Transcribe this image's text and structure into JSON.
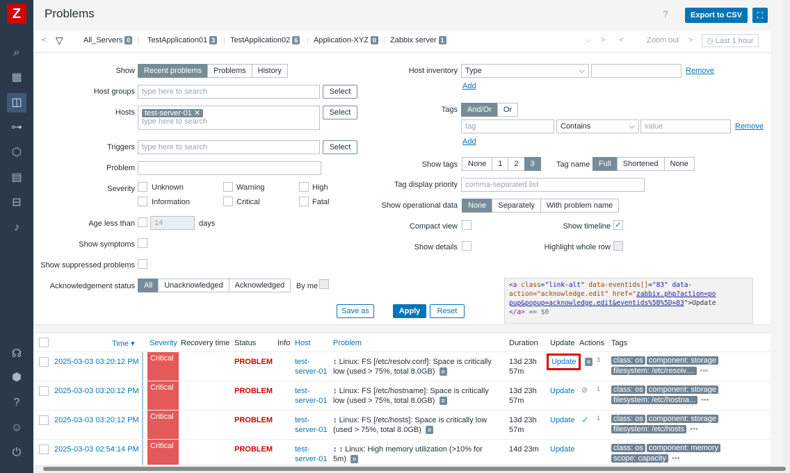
{
  "header": {
    "title": "Problems",
    "export_label": "Export to CSV",
    "help": "?"
  },
  "sidebar": {
    "logo": "Z",
    "items": [
      "search-icon",
      "dashboard-icon",
      "monitoring-icon",
      "services-icon",
      "inventory-icon",
      "reports-icon",
      "data-collection-icon",
      "alerts-icon"
    ],
    "bottom": [
      "support-icon",
      "integrations-icon",
      "help-icon",
      "user-settings-icon",
      "sign-out-icon"
    ]
  },
  "tabs": {
    "items": [
      {
        "label": "All_Servers",
        "count": "0"
      },
      {
        "label": "TestApplication01",
        "count": "3"
      },
      {
        "label": "TestApplication02",
        "count": "6"
      },
      {
        "label": "Application-XYZ",
        "count": "0"
      },
      {
        "label": "Zabbix server",
        "count": "1"
      }
    ],
    "zoom_out": "Zoom out",
    "last": "Last 1 hour"
  },
  "filter": {
    "show_label": "Show",
    "show_opts": [
      "Recent problems",
      "Problems",
      "History"
    ],
    "host_groups_label": "Host groups",
    "host_groups_placeholder": "type here to search",
    "select": "Select",
    "hosts_label": "Hosts",
    "host_chip": "test-server-01",
    "hosts_placeholder": "type here to search",
    "triggers_label": "Triggers",
    "triggers_placeholder": "type here to search",
    "problem_label": "Problem",
    "severity_label": "Severity",
    "severities": [
      "Unknown",
      "Warning",
      "High",
      "Information",
      "Critical",
      "Fatal"
    ],
    "age_label": "Age less than",
    "age_value": "14",
    "age_unit": "days",
    "symptoms_label": "Show symptoms",
    "suppressed_label": "Show suppressed problems",
    "ack_label": "Acknowledgement status",
    "ack_opts": [
      "All",
      "Unacknowledged",
      "Acknowledged"
    ],
    "by_me": "By me",
    "inventory_label": "Host inventory",
    "inventory_value": "Type",
    "remove": "Remove",
    "add": "Add",
    "tags_label": "Tags",
    "tags_opts": [
      "And/Or",
      "Or"
    ],
    "tag_placeholder": "tag",
    "tag_op": "Contains",
    "value_placeholder": "value",
    "show_tags_label": "Show tags",
    "show_tags_opts": [
      "None",
      "1",
      "2",
      "3"
    ],
    "tag_name_label": "Tag name",
    "tag_name_opts": [
      "Full",
      "Shortened",
      "None"
    ],
    "tag_priority_label": "Tag display priority",
    "tag_priority_placeholder": "comma-separated list",
    "opdata_label": "Show operational data",
    "opdata_opts": [
      "None",
      "Separately",
      "With problem name"
    ],
    "compact_label": "Compact view",
    "timeline_label": "Show timeline",
    "details_label": "Show details",
    "highlight_label": "Highlight whole row",
    "save_as": "Save as",
    "apply": "Apply",
    "reset": "Reset"
  },
  "tooltip": {
    "line1a": "<a ",
    "line1b": "class",
    "line1c": "=\"link-alt\" ",
    "line1d": "data-eventids[]",
    "line1e": "=\"83\" data-",
    "line2": "action=\"acknowledge.edit\" href=\"",
    "line2u": "zabbix.php?action=po",
    "line3u": "pup&popup=acknowledge.edit&eventids%5B%5D=83",
    "line3b": "\">Update",
    "line4": "</a>",
    "line4c": " == $0"
  },
  "table": {
    "headers": {
      "time": "Time ▾",
      "severity": "Severity",
      "recovery": "Recovery time",
      "status": "Status",
      "info": "Info",
      "host": "Host",
      "problem": "Problem",
      "duration": "Duration",
      "update": "Update",
      "actions": "Actions",
      "tags": "Tags"
    },
    "rows": [
      {
        "time": "2025-03-03 03:20:12 PM",
        "severity": "Critical",
        "status": "PROBLEM",
        "host1": "test-",
        "host2": "server-01",
        "p1": "Linux: FS [/etc/resolv.conf]: Space is critically",
        "p2": "low (used > 75%, total 8.0GB)",
        "d1": "13d 23h",
        "d2": "57m",
        "update": "Update",
        "action_count": "3",
        "tags": [
          "class: os",
          "component: storage"
        ],
        "tag2": "filesystem: /etc/resolv...."
      },
      {
        "time": "2025-03-03 03:20:12 PM",
        "severity": "Critical",
        "status": "PROBLEM",
        "host1": "test-",
        "host2": "server-01",
        "p1": "Linux: FS [/etc/hostname]: Space is critically",
        "p2": "low (used > 75%, total 8.0GB)",
        "d1": "13d 23h",
        "d2": "57m",
        "update": "Update",
        "action_count": "1",
        "tags": [
          "class: os",
          "component: storage"
        ],
        "tag2": "filesystem: /etc/hostna..."
      },
      {
        "time": "2025-03-03 03:20:12 PM",
        "severity": "Critical",
        "status": "PROBLEM",
        "host1": "test-",
        "host2": "server-01",
        "p1": "Linux: FS [/etc/hosts]: Space is critically low",
        "p2": "(used > 75%, total 8.0GB)",
        "d1": "13d 23h",
        "d2": "57m",
        "update": "Update",
        "action_count": "1",
        "tags": [
          "class: os",
          "component: storage"
        ],
        "tag2": "filesystem: /etc/hosts"
      },
      {
        "time": "2025-03-03 02:54:14 PM",
        "severity": "Critical",
        "status": "PROBLEM",
        "host1": "test-",
        "host2": "server-01",
        "p1": "Linux: High memory utilization (>10% for",
        "p2": "5m)",
        "d1": "14d 23m",
        "d2": "",
        "update": "Update",
        "action_count": "",
        "tags": [
          "class: os",
          "component: memory"
        ],
        "tag2": "scope: capacity"
      }
    ]
  }
}
